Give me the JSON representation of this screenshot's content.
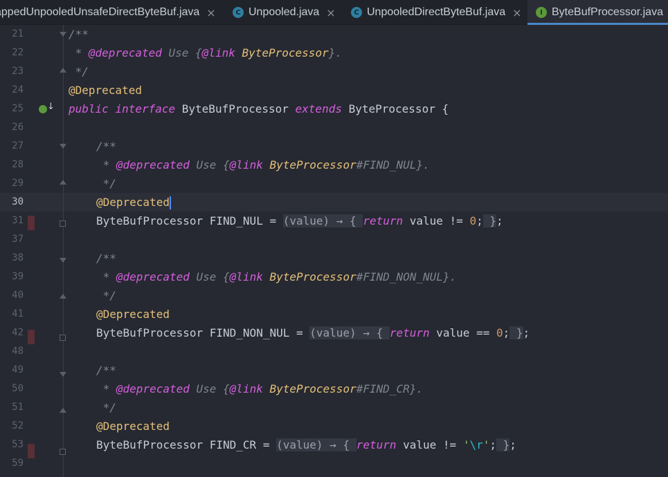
{
  "tabs": [
    {
      "label": "appedUnpooledUnsafeDirectByteBuf.java",
      "icon": "none",
      "active": false
    },
    {
      "label": "Unpooled.java",
      "icon": "class-icon",
      "active": false
    },
    {
      "label": "UnpooledDirectByteBuf.java",
      "icon": "class-icon",
      "active": false
    },
    {
      "label": "ByteBufProcessor.java",
      "icon": "interface-icon",
      "active": true
    }
  ],
  "tab_close_glyph": "×",
  "tab_icon_letters": {
    "class": "C",
    "interface": "I"
  },
  "lines": {
    "l21": {
      "num": "21",
      "t1": "/**"
    },
    "l22": {
      "num": "22",
      "t1": " * ",
      "t2": "@deprecated",
      "t3": " Use {",
      "t4": "@link",
      "t5": " ByteProcessor",
      "t6": "}."
    },
    "l23": {
      "num": "23",
      "t1": " */"
    },
    "l24": {
      "num": "24",
      "t1": "@Deprecated"
    },
    "l25": {
      "num": "25",
      "t1": "public",
      "t2": " ",
      "t3": "interface",
      "t4": " ByteBufProcessor ",
      "t5": "extends",
      "t6": " ByteProcessor {"
    },
    "l26": {
      "num": "26"
    },
    "l27": {
      "num": "27",
      "t1": "/**"
    },
    "l28": {
      "num": "28",
      "t1": " * ",
      "t2": "@deprecated",
      "t3": " Use {",
      "t4": "@link",
      "t5": " ByteProcessor",
      "t6": "#FIND_NUL}."
    },
    "l29": {
      "num": "29",
      "t1": " */"
    },
    "l30": {
      "num": "30",
      "t1": "@Deprecated"
    },
    "l31": {
      "num": "31",
      "t1": "ByteBufProcessor FIND_NUL = ",
      "t2": "(value) → { ",
      "t3": "return",
      "t4": " value != ",
      "t5": "0",
      "t6": ";",
      "t7": " }",
      "t8": ";"
    },
    "l37": {
      "num": "37"
    },
    "l38": {
      "num": "38",
      "t1": "/**"
    },
    "l39": {
      "num": "39",
      "t1": " * ",
      "t2": "@deprecated",
      "t3": " Use {",
      "t4": "@link",
      "t5": " ByteProcessor",
      "t6": "#FIND_NON_NUL}."
    },
    "l40": {
      "num": "40",
      "t1": " */"
    },
    "l41": {
      "num": "41",
      "t1": "@Deprecated"
    },
    "l42": {
      "num": "42",
      "t1": "ByteBufProcessor FIND_NON_NUL = ",
      "t2": "(value) → { ",
      "t3": "return",
      "t4": " value == ",
      "t5": "0",
      "t6": ";",
      "t7": " }",
      "t8": ";"
    },
    "l48": {
      "num": "48"
    },
    "l49": {
      "num": "49",
      "t1": "/**"
    },
    "l50": {
      "num": "50",
      "t1": " * ",
      "t2": "@deprecated",
      "t3": " Use {",
      "t4": "@link",
      "t5": " ByteProcessor",
      "t6": "#FIND_CR}."
    },
    "l51": {
      "num": "51",
      "t1": " */"
    },
    "l52": {
      "num": "52",
      "t1": "@Deprecated"
    },
    "l53": {
      "num": "53",
      "t1": "ByteBufProcessor FIND_CR = ",
      "t2": "(value) → { ",
      "t3": "return",
      "t4": " value != ",
      "t5": "'",
      "t6": "\\r",
      "t7": "'",
      "t8": ";",
      "t9": " }",
      "t10": ";"
    },
    "l59": {
      "num": "59"
    }
  },
  "colors": {
    "background": "#262931",
    "keyword": "#d55fde",
    "annotation": "#e5c07b",
    "comment": "#7f8490",
    "number": "#d19a66",
    "active_tab_underline": "#4a88c7"
  }
}
